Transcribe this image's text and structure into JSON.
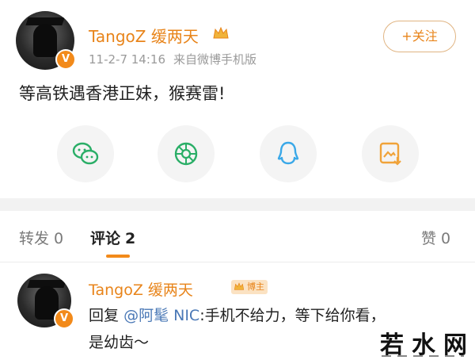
{
  "post": {
    "username": "TangoZ 缓两天",
    "timestamp": "11-2-7 14:16",
    "source": "来自微博手机版",
    "follow_label": "+关注",
    "text": "等高铁遇香港正妹，猴赛雷!",
    "verified_badge": "V",
    "share_actions": [
      {
        "name": "wechat",
        "icon": "wechat-icon",
        "color": "#2aae67"
      },
      {
        "name": "moments",
        "icon": "moments-icon",
        "color": "#2aae67"
      },
      {
        "name": "qq",
        "icon": "qq-icon",
        "color": "#3aa8e8"
      },
      {
        "name": "save-image",
        "icon": "save-image-icon",
        "color": "#f0a33a"
      }
    ]
  },
  "tabs": {
    "repost_label": "转发",
    "repost_count": "0",
    "comment_label": "评论",
    "comment_count": "2",
    "like_label": "赞",
    "like_count": "0"
  },
  "comment": {
    "username": "TangoZ 缓两天",
    "tag": "博主",
    "reply_prefix": "回复",
    "mention": "@阿髦 NIC",
    "reply_text": ":手机不给力，等下给你看，",
    "reply_text2": "是幼齿～"
  },
  "watermark": {
    "text": "若水网"
  },
  "colors": {
    "accent": "#e8841a",
    "mention": "#4a78b6",
    "badge": "#f28a1a"
  }
}
